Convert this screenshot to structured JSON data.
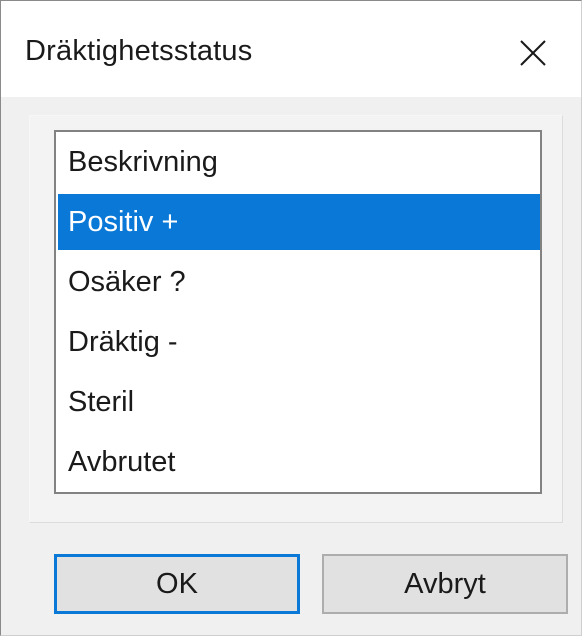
{
  "window": {
    "title": "Dräktighetsstatus",
    "close_icon": "close-icon"
  },
  "listbox": {
    "items": [
      {
        "label": "Beskrivning",
        "selected": false
      },
      {
        "label": "Positiv +",
        "selected": true
      },
      {
        "label": "Osäker ?",
        "selected": false
      },
      {
        "label": "Dräktig -",
        "selected": false
      },
      {
        "label": "Steril",
        "selected": false
      },
      {
        "label": "Avbrutet",
        "selected": false
      }
    ],
    "selection_color": "#0a78d7"
  },
  "buttons": {
    "ok_label": "OK",
    "cancel_label": "Avbryt"
  }
}
